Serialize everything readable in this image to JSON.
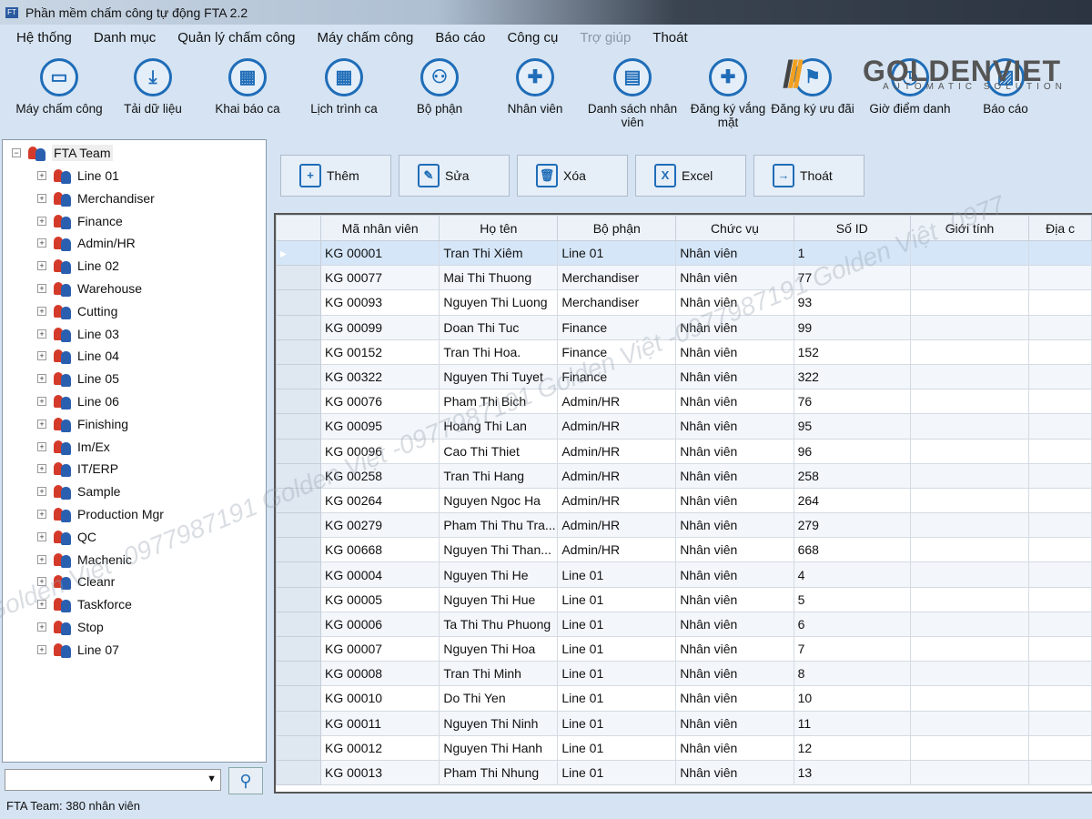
{
  "window": {
    "title": "Phần mềm chấm công tự động FTA 2.2",
    "icon": "FT"
  },
  "menu": [
    "Hệ thống",
    "Danh mục",
    "Quản lý chấm công",
    "Máy chấm công",
    "Báo cáo",
    "Công cụ",
    "Trợ giúp",
    "Thoát"
  ],
  "menu_disabled": "Trợ giúp",
  "toolbar": [
    {
      "label": "Máy chấm công",
      "icon": "device-icon"
    },
    {
      "label": "Tải dữ liệu",
      "icon": "download-icon"
    },
    {
      "label": "Khai báo ca",
      "icon": "calendar-add-icon"
    },
    {
      "label": "Lịch trình ca",
      "icon": "schedule-icon"
    },
    {
      "label": "Bộ phận",
      "icon": "org-chart-icon"
    },
    {
      "label": "Nhân viên",
      "icon": "employee-add-icon"
    },
    {
      "label": "Danh sách nhân viên",
      "icon": "employee-list-icon"
    },
    {
      "label": "Đăng ký vắng mặt",
      "icon": "user-add-icon"
    },
    {
      "label": "Đăng ký ưu đãi",
      "icon": "benefit-icon"
    },
    {
      "label": "Giờ điểm danh",
      "icon": "clock-icon"
    },
    {
      "label": "Báo cáo",
      "icon": "report-icon"
    }
  ],
  "logo": {
    "name": "GOLDENVIET",
    "tagline": "AUTOMATIC SOLUTION"
  },
  "tree": {
    "root": "FTA Team",
    "children": [
      "Line 01",
      "Merchandiser",
      "Finance",
      "Admin/HR",
      "Line 02",
      "Warehouse",
      "Cutting",
      "Line 03",
      "Line 04",
      "Line 05",
      "Line 06",
      "Finishing",
      "Im/Ex",
      "IT/ERP",
      "Sample",
      "Production Mgr",
      "QC",
      "Machenic",
      "Cleanr",
      "Taskforce",
      "Stop",
      "Line 07"
    ]
  },
  "search": {
    "value": ""
  },
  "status": "FTA Team: 380 nhân viên",
  "actions": [
    {
      "label": "Thêm",
      "icon": "add-document-icon"
    },
    {
      "label": "Sửa",
      "icon": "edit-icon"
    },
    {
      "label": "Xóa",
      "icon": "trash-icon"
    },
    {
      "label": "Excel",
      "icon": "excel-icon"
    },
    {
      "label": "Thoát",
      "icon": "exit-icon"
    }
  ],
  "grid": {
    "columns": [
      "Mã nhân viên",
      "Họ tên",
      "Bộ phận",
      "Chức vụ",
      "Số ID",
      "Giới tính",
      "Địa c"
    ],
    "rows": [
      [
        "KG 00001",
        "Tran Thi Xiêm",
        "Line 01",
        "Nhân viên",
        "1"
      ],
      [
        "KG 00077",
        "Mai Thi Thuong",
        "Merchandiser",
        "Nhân viên",
        "77"
      ],
      [
        "KG 00093",
        "Nguyen Thi Luong",
        "Merchandiser",
        "Nhân viên",
        "93"
      ],
      [
        "KG 00099",
        "Doan Thi Tuc",
        "Finance",
        "Nhân viên",
        "99"
      ],
      [
        "KG 00152",
        "Tran Thi Hoa.",
        "Finance",
        "Nhân viên",
        "152"
      ],
      [
        "KG 00322",
        "Nguyen Thi Tuyet",
        "Finance",
        "Nhân viên",
        "322"
      ],
      [
        "KG 00076",
        "Pham Thi Bich",
        "Admin/HR",
        "Nhân viên",
        "76"
      ],
      [
        "KG 00095",
        "Hoang Thi Lan",
        "Admin/HR",
        "Nhân viên",
        "95"
      ],
      [
        "KG 00096",
        "Cao Thi Thiet",
        "Admin/HR",
        "Nhân viên",
        "96"
      ],
      [
        "KG 00258",
        "Tran Thi Hang",
        "Admin/HR",
        "Nhân viên",
        "258"
      ],
      [
        "KG 00264",
        "Nguyen Ngoc Ha",
        "Admin/HR",
        "Nhân viên",
        "264"
      ],
      [
        "KG 00279",
        "Pham Thi Thu Tra...",
        "Admin/HR",
        "Nhân viên",
        "279"
      ],
      [
        "KG 00668",
        "Nguyen Thi Than...",
        "Admin/HR",
        "Nhân viên",
        "668"
      ],
      [
        "KG 00004",
        "Nguyen Thi He",
        "Line 01",
        "Nhân viên",
        "4"
      ],
      [
        "KG 00005",
        "Nguyen Thi Hue",
        "Line 01",
        "Nhân viên",
        "5"
      ],
      [
        "KG 00006",
        "Ta Thi Thu Phuong",
        "Line 01",
        "Nhân viên",
        "6"
      ],
      [
        "KG 00007",
        "Nguyen Thi Hoa",
        "Line 01",
        "Nhân viên",
        "7"
      ],
      [
        "KG 00008",
        "Tran Thi Minh",
        "Line 01",
        "Nhân viên",
        "8"
      ],
      [
        "KG 00010",
        "Do Thi Yen",
        "Line 01",
        "Nhân viên",
        "10"
      ],
      [
        "KG 00011",
        "Nguyen Thi Ninh",
        "Line 01",
        "Nhân viên",
        "11"
      ],
      [
        "KG 00012",
        "Nguyen Thi Hanh",
        "Line 01",
        "Nhân viên",
        "12"
      ],
      [
        "KG 00013",
        "Pham Thi Nhung",
        "Line 01",
        "Nhân viên",
        "13"
      ]
    ]
  },
  "watermark": "Golden Việt -0977987191 Golden Việt -0977987191 Golden Việt -0977987191 Golden Việt -0977"
}
